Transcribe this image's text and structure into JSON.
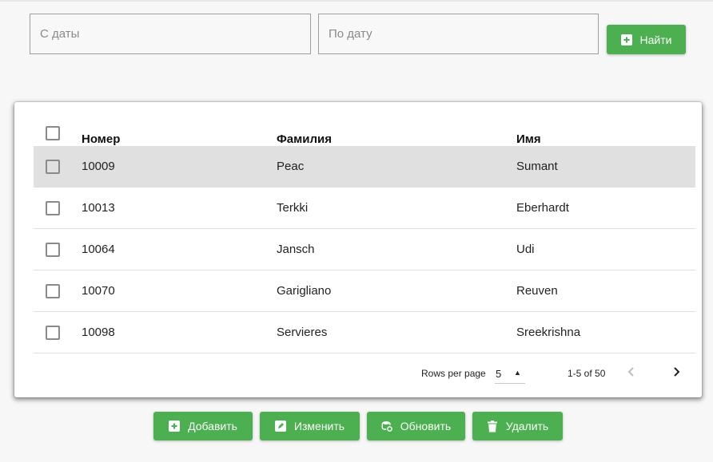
{
  "filters": {
    "from_placeholder": "С даты",
    "to_placeholder": "По дату",
    "find_label": "Найти"
  },
  "table": {
    "columns": [
      "Номер",
      "Фамилия",
      "Имя"
    ],
    "rows": [
      {
        "number": "10009",
        "last_name": "Peac",
        "first_name": "Sumant"
      },
      {
        "number": "10013",
        "last_name": "Terkki",
        "first_name": "Eberhardt"
      },
      {
        "number": "10064",
        "last_name": "Jansch",
        "first_name": "Udi"
      },
      {
        "number": "10070",
        "last_name": "Garigliano",
        "first_name": "Reuven"
      },
      {
        "number": "10098",
        "last_name": "Servieres",
        "first_name": "Sreekrishna"
      }
    ],
    "selected_row": 0
  },
  "pagination": {
    "rows_per_page_label": "Rows per page",
    "rows_per_page_value": "5",
    "range": "1-5 of 50"
  },
  "actions": {
    "add_label": "Добавить",
    "edit_label": "Изменить",
    "refresh_label": "Обновить",
    "delete_label": "Удалить"
  },
  "colors": {
    "accent": "#4caf50",
    "selected_row": "#e0e0e0"
  },
  "icons": {
    "find": "plus-box-icon",
    "add": "plus-box-icon",
    "edit": "pencil-box-icon",
    "refresh": "database-refresh-icon",
    "delete": "trash-icon",
    "prev": "chevron-left-icon",
    "next": "chevron-right-icon",
    "select": "triangle-down-icon"
  }
}
